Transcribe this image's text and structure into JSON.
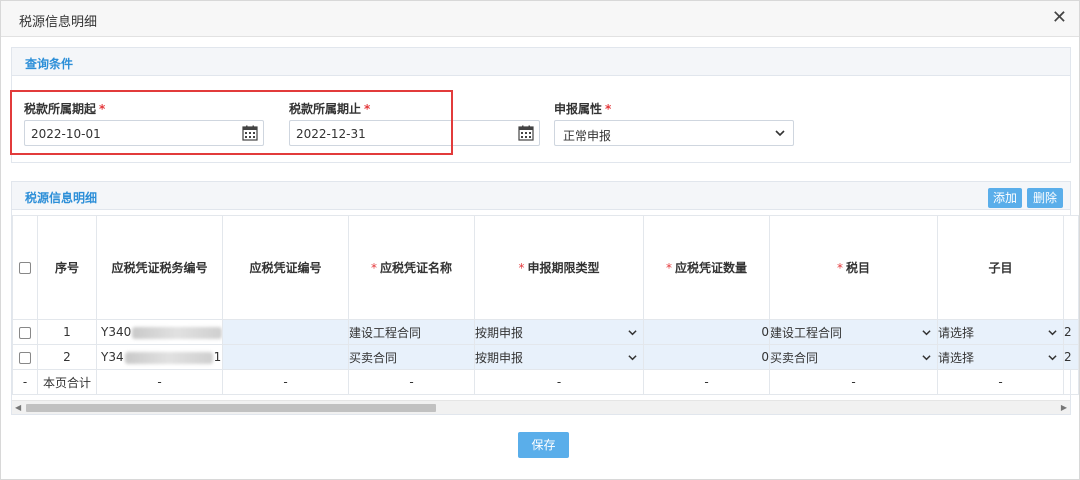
{
  "dialog": {
    "title": "税源信息明细"
  },
  "query": {
    "title": "查询条件",
    "start_label": "税款所属期起",
    "start_value": "2022-10-01",
    "end_label": "税款所属期止",
    "end_value": "2022-12-31",
    "attr_label": "申报属性",
    "attr_value": "正常申报",
    "required_mark": "*"
  },
  "detail": {
    "title": "税源信息明细",
    "add_label": "添加",
    "delete_label": "删除",
    "columns": [
      "序号",
      "应税凭证税务编号",
      "应税凭证编号",
      "应税凭证名称",
      "申报期限类型",
      "应税凭证数量",
      "税目",
      "子目"
    ],
    "rows": [
      {
        "index": "1",
        "tax_no_prefix": "Y340",
        "tax_no_suffix": "05",
        "voucher_no": "",
        "voucher_name": "建设工程合同",
        "period_type": "按期申报",
        "quantity": "0",
        "tax_item": "建设工程合同",
        "sub_item": "请选择",
        "overflow": "2"
      },
      {
        "index": "2",
        "tax_no_prefix": "Y34",
        "tax_no_suffix": "105",
        "voucher_no": "",
        "voucher_name": "买卖合同",
        "period_type": "按期申报",
        "quantity": "0",
        "tax_item": "买卖合同",
        "sub_item": "请选择",
        "overflow": "2"
      }
    ],
    "total": {
      "dash": "-",
      "label": "本页合计"
    }
  },
  "footer": {
    "save_label": "保存"
  },
  "colors": {
    "accent": "#5aaeea",
    "title_blue": "#2d8fd8",
    "required": "#e4393c",
    "highlight": "#e23b3b",
    "editable_cell": "#e8f1fb"
  },
  "icons": {
    "close": "close-icon",
    "calendar": "calendar-icon",
    "dropdown": "chevron-down-icon"
  }
}
